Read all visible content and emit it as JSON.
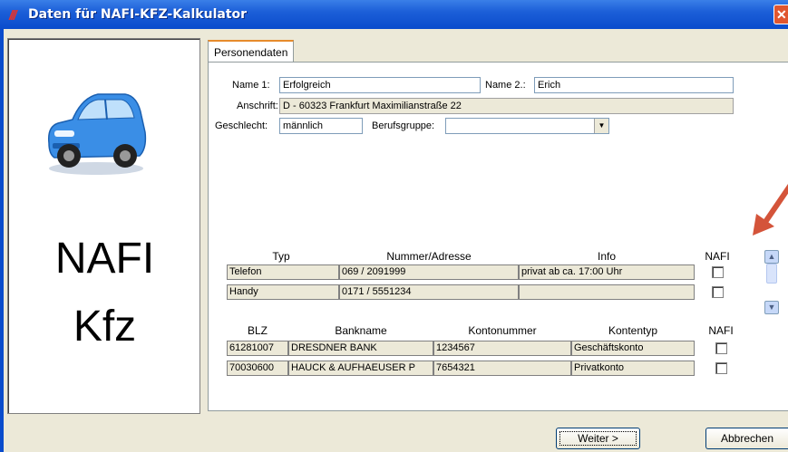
{
  "window": {
    "title": "Daten für NAFI-KFZ-Kalkulator",
    "close_glyph": "✕"
  },
  "sidepanel": {
    "line1": "NAFI",
    "line2": "Kfz",
    "car_color": "#3a8ee6"
  },
  "tabs": [
    {
      "label": "Personendaten"
    }
  ],
  "form": {
    "name1_label": "Name 1:",
    "name1_value": "Erfolgreich",
    "name2_label": "Name 2.:",
    "name2_value": "Erich",
    "anschrift_label": "Anschrift:",
    "anschrift_value": "D - 60323  Frankfurt  Maximilianstraße 22",
    "geschlecht_label": "Geschlecht:",
    "geschlecht_value": "männlich",
    "berufsgruppe_label": "Berufsgruppe:",
    "berufsgruppe_value": ""
  },
  "contacts": {
    "headers": {
      "typ": "Typ",
      "nummer": "Nummer/Adresse",
      "info": "Info",
      "nafi": "NAFI"
    },
    "rows": [
      {
        "typ": "Telefon",
        "nummer": "069 / 2091999",
        "info": "privat ab ca. 17:00 Uhr"
      },
      {
        "typ": "Handy",
        "nummer": "0171 / 5551234",
        "info": ""
      }
    ]
  },
  "bank": {
    "headers": {
      "blz": "BLZ",
      "bankname": "Bankname",
      "kontonummer": "Kontonummer",
      "kontentyp": "Kontentyp",
      "nafi": "NAFI"
    },
    "rows": [
      {
        "blz": "61281007",
        "bankname": "DRESDNER BANK",
        "kontonummer": "1234567",
        "kontentyp": "Geschäftskonto"
      },
      {
        "blz": "70030600",
        "bankname": "HAUCK & AUFHAEUSER P",
        "kontonummer": "7654321",
        "kontentyp": "Privatkonto"
      }
    ]
  },
  "buttons": {
    "weiter": "Weiter >",
    "abbrechen": "Abbrechen"
  },
  "colors": {
    "titlebar": "#0a4ccc",
    "annotation_arrow": "#d4543a",
    "dialog_bg": "#ece9d8"
  }
}
